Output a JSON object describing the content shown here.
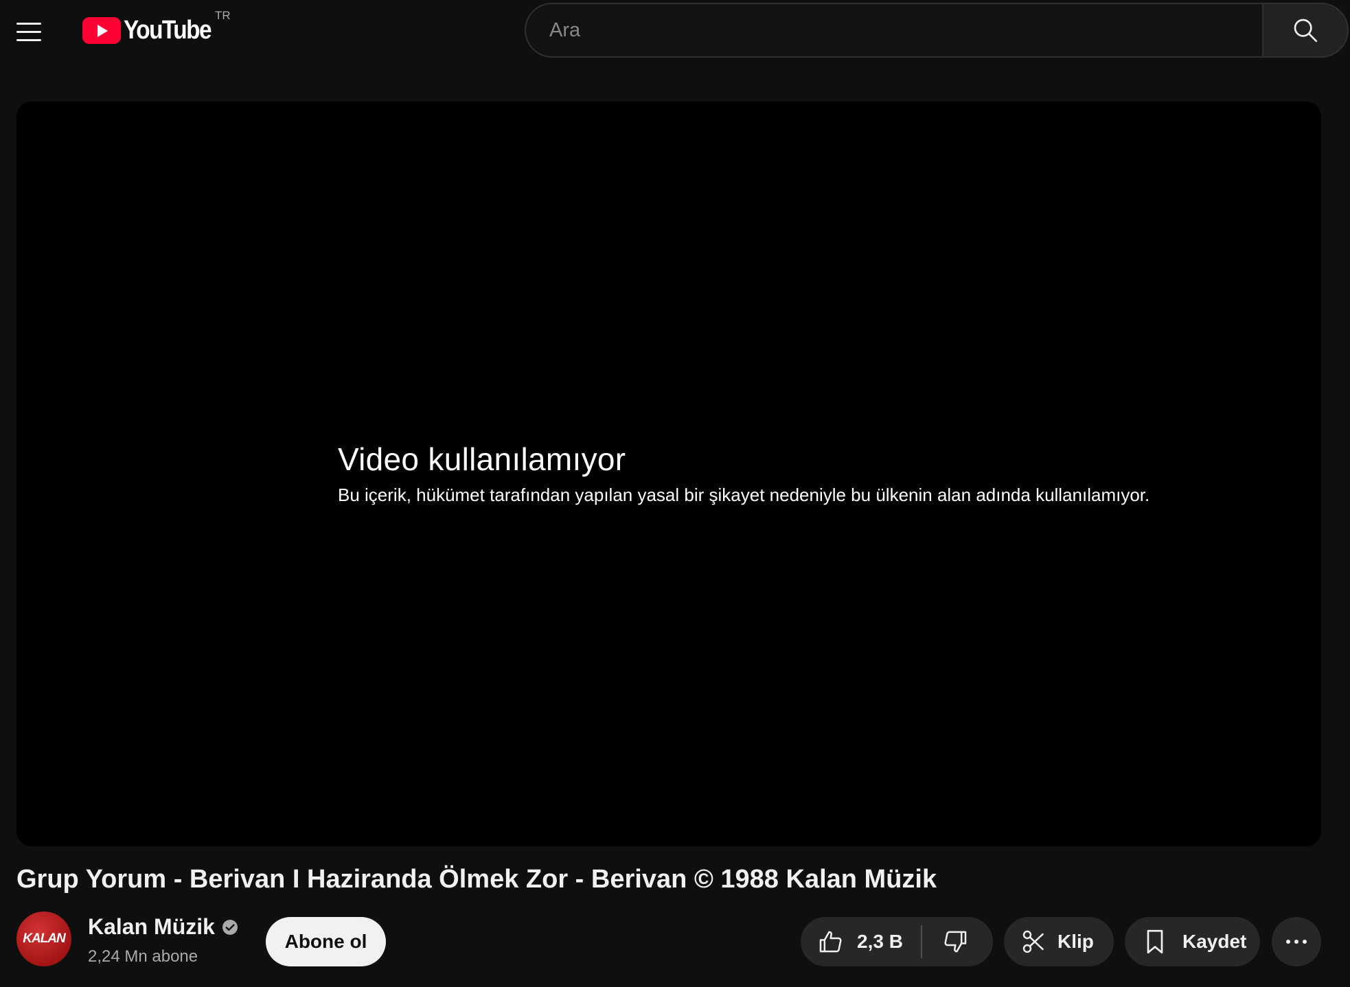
{
  "header": {
    "logo_text": "YouTube",
    "country_code": "TR",
    "search": {
      "placeholder": "Ara"
    }
  },
  "player": {
    "status_title": "Video kullanılamıyor",
    "status_message": "Bu içerik, hükümet tarafından yapılan yasal bir şikayet nedeniyle bu ülkenin alan adında kullanılamıyor."
  },
  "video": {
    "title": "Grup Yorum - Berivan I Haziranda Ölmek Zor - Berivan © 1988 Kalan Müzik"
  },
  "channel": {
    "avatar_text": "KALAN",
    "name": "Kalan Müzik",
    "subscribers": "2,24 Mn abone",
    "subscribe_label": "Abone ol"
  },
  "actions": {
    "like_count": "2,3 B",
    "clip_label": "Klip",
    "save_label": "Kaydet"
  },
  "colors": {
    "background": "#0f0f0f",
    "brand_red": "#ff0033",
    "pill_bg": "#272727"
  }
}
